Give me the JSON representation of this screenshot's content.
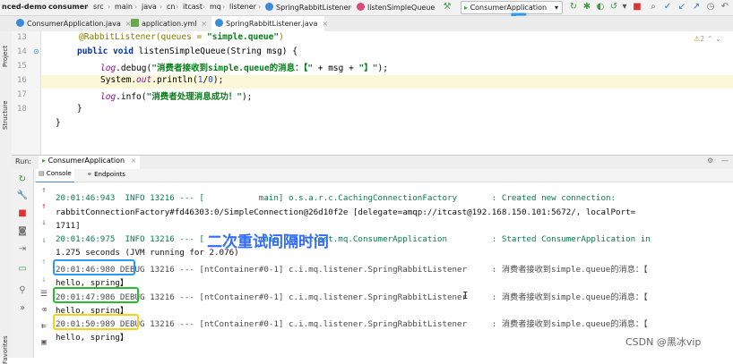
{
  "breadcrumb": {
    "items": [
      "nced-demo",
      "consumer",
      "src",
      "main",
      "java",
      "cn",
      "itcast",
      "mq",
      "listener",
      "SpringRabbitListener",
      "listenSimpleQueue"
    ]
  },
  "toolbar": {
    "run_config": "ConsumerApplication"
  },
  "tabs": [
    {
      "label": "ConsumerApplication.java",
      "active": false
    },
    {
      "label": "application.yml",
      "active": false
    },
    {
      "label": "SpringRabbitListener.java",
      "active": true
    }
  ],
  "sidebar": {
    "project": "Project",
    "structure": "Structure",
    "favorites": "Favorites"
  },
  "editor": {
    "line_numbers": [
      "13",
      "14",
      "15",
      "16",
      "17",
      "18"
    ],
    "inspection_count": "2",
    "lines": {
      "l1_ann": "@RabbitListener(queues = ",
      "l1_str": "\"simple.queue\"",
      "l1_end": ")",
      "l2_kw": "public void ",
      "l2_rest": "listenSimpleQueue(String msg) {",
      "l3_obj": "log",
      "l3_mid": ".debug(",
      "l3_str": "\"消费者接收到simple.queue的消息：【\"",
      "l3_end": " + msg + ",
      "l3_str2": "\"】\"",
      "l3_close": ");",
      "l4_pre": "System.",
      "l4_out": "out",
      "l4_mid": ".println(",
      "l4_n1": "1",
      "l4_slash": "/",
      "l4_n2": "0",
      "l4_end": ");",
      "l5_obj": "log",
      "l5_mid": ".info(",
      "l5_str": "\"消费者处理消息成功！\"",
      "l5_end": ");",
      "l6": "}",
      "l7": "}"
    }
  },
  "run": {
    "label": "Run:",
    "config_tab": "ConsumerApplication",
    "console_tab": "Console",
    "endpoints_tab": "Endpoints"
  },
  "console": {
    "lines": [
      {
        "text": "20:01:46:943  INFO 13216 --- [           main] o.s.a.r.c.CachingConnectionFactory       : Created new connection:",
        "type": "info"
      },
      {
        "text": "rabbitConnectionFactory#fd46303:0/SimpleConnection@26d10f2e [delegate=amqp://itcast@192.168.150.101:5672/, localPort=",
        "type": "plain"
      },
      {
        "text": "1711]",
        "type": "plain"
      },
      {
        "text": "20:01:46:975  INFO 13216 --- [           main] cn.itcast.mq.ConsumerApplication         : Started ConsumerApplication in",
        "type": "info"
      },
      {
        "text": "1.275 seconds (JVM running for 2.076)",
        "type": "plain"
      },
      {
        "text": "20:01:46:980 DEBUG 13216 --- [ntContainer#0-1] c.i.mq.listener.SpringRabbitListener     : 消费者接收到simple.queue的消息：【",
        "type": "debug"
      },
      {
        "text": "hello, spring】",
        "type": "plain"
      },
      {
        "text": "20:01:47:986 DEBUG 13216 --- [ntContainer#0-1] c.i.mq.listener.SpringRabbitListener     : 消费者接收到simple.queue的消息：【",
        "type": "debug"
      },
      {
        "text": "hello, spring】",
        "type": "plain"
      },
      {
        "text": "20:01:50:989 DEBUG 13216 --- [ntContainer#0-1] c.i.mq.listener.SpringRabbitListener     : 消费者接收到simple.queue的消息：【",
        "type": "debug"
      },
      {
        "text": "hello, spring】",
        "type": "plain"
      }
    ]
  },
  "annotation": {
    "overlay_text": "二次重试间隔时间",
    "box_colors": [
      "#2d9cf0",
      "#22c02a",
      "#f2d21a"
    ],
    "arrow_color": "#2d9cf0"
  },
  "watermark": "CSDN @黑冰vip"
}
